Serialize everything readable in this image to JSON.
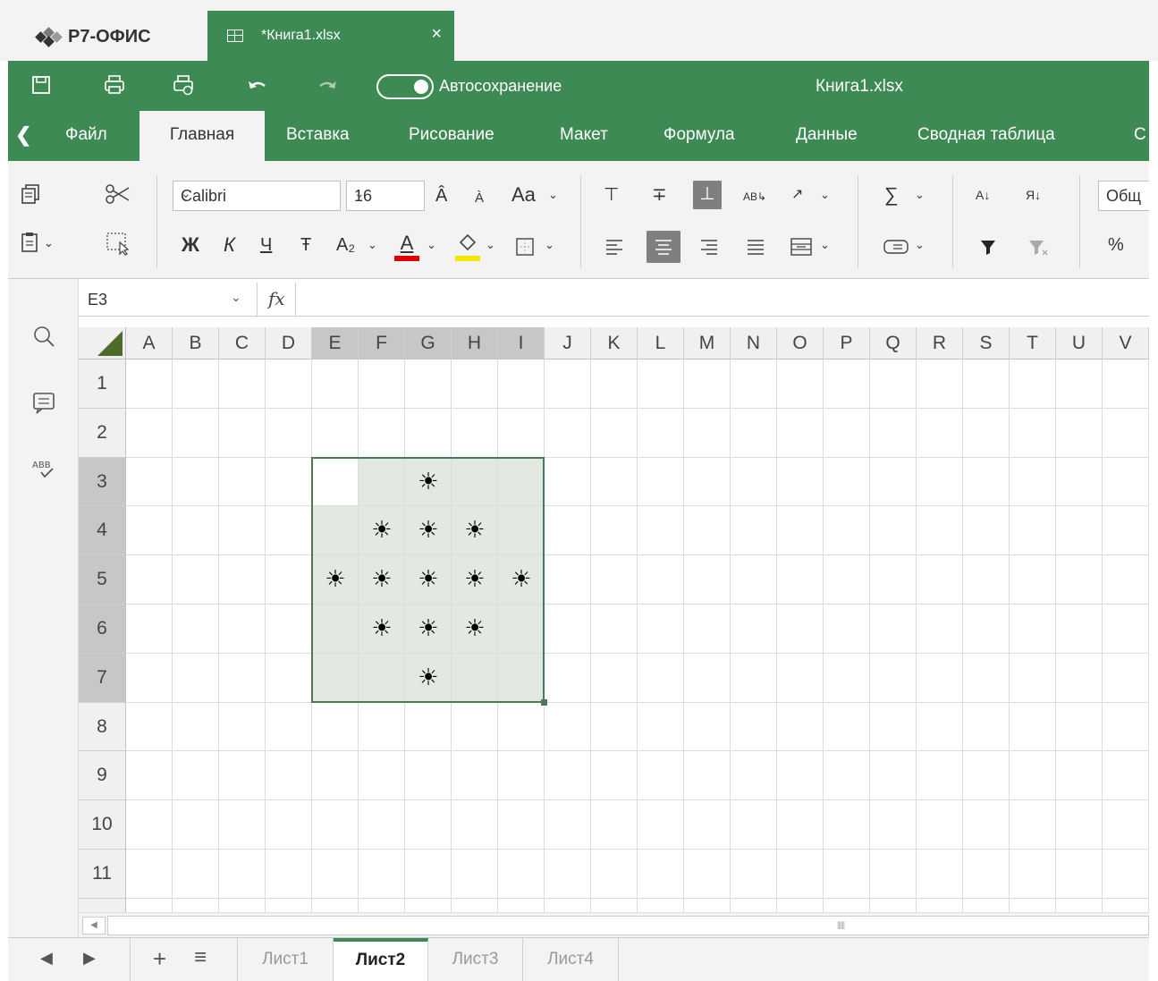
{
  "app": {
    "logo_text": "Р7-ОФИС"
  },
  "doc_tab": {
    "label": "*Книга1.xlsx",
    "close": "×"
  },
  "quick_access": {
    "autosave_label": "Автосохранение",
    "autosave_on": true,
    "doc_title": "Книга1.xlsx"
  },
  "menu": {
    "back": "‹",
    "tabs": [
      "Файл",
      "Главная",
      "Вставка",
      "Рисование",
      "Макет",
      "Формула",
      "Данные",
      "Сводная таблица",
      "С"
    ],
    "active": "Главная"
  },
  "ribbon": {
    "font_name": "Calibri",
    "font_size": "16",
    "bold": "Ж",
    "italic": "К",
    "underline": "Ч",
    "strikethrough": "Ŧ",
    "number_format": "Общ",
    "percent": "%",
    "font_color": "#e00000",
    "highlight_color": "#f5e600"
  },
  "formula_bar": {
    "cell_ref": "E3",
    "fx": "fx",
    "formula": ""
  },
  "grid": {
    "columns": [
      "A",
      "B",
      "C",
      "D",
      "E",
      "F",
      "G",
      "H",
      "I",
      "J",
      "K",
      "L",
      "M",
      "N",
      "O",
      "P",
      "Q",
      "R",
      "S",
      "T",
      "U",
      "V"
    ],
    "rows": [
      "1",
      "2",
      "3",
      "4",
      "5",
      "6",
      "7",
      "8",
      "9",
      "10",
      "11"
    ],
    "selected_columns": [
      "E",
      "F",
      "G",
      "H",
      "I"
    ],
    "selected_rows": [
      "3",
      "4",
      "5",
      "6",
      "7"
    ],
    "selection": "E3:I7",
    "cells": [
      {
        "ref": "G3",
        "value": "☀"
      },
      {
        "ref": "F4",
        "value": "☀"
      },
      {
        "ref": "G4",
        "value": "☀"
      },
      {
        "ref": "H4",
        "value": "☀"
      },
      {
        "ref": "E5",
        "value": "☀"
      },
      {
        "ref": "F5",
        "value": "☀"
      },
      {
        "ref": "G5",
        "value": "☀"
      },
      {
        "ref": "H5",
        "value": "☀"
      },
      {
        "ref": "I5",
        "value": "☀"
      },
      {
        "ref": "F6",
        "value": "☀"
      },
      {
        "ref": "G6",
        "value": "☀"
      },
      {
        "ref": "H6",
        "value": "☀"
      },
      {
        "ref": "G7",
        "value": "☀"
      }
    ]
  },
  "sheets": {
    "tabs": [
      "Лист1",
      "Лист2",
      "Лист3",
      "Лист4"
    ],
    "active": "Лист2",
    "add": "+",
    "list": "≡"
  },
  "colors": {
    "brand": "#3d8a55",
    "selection_fill": "#e3e8e3",
    "selection_border": "#4c7a55"
  }
}
